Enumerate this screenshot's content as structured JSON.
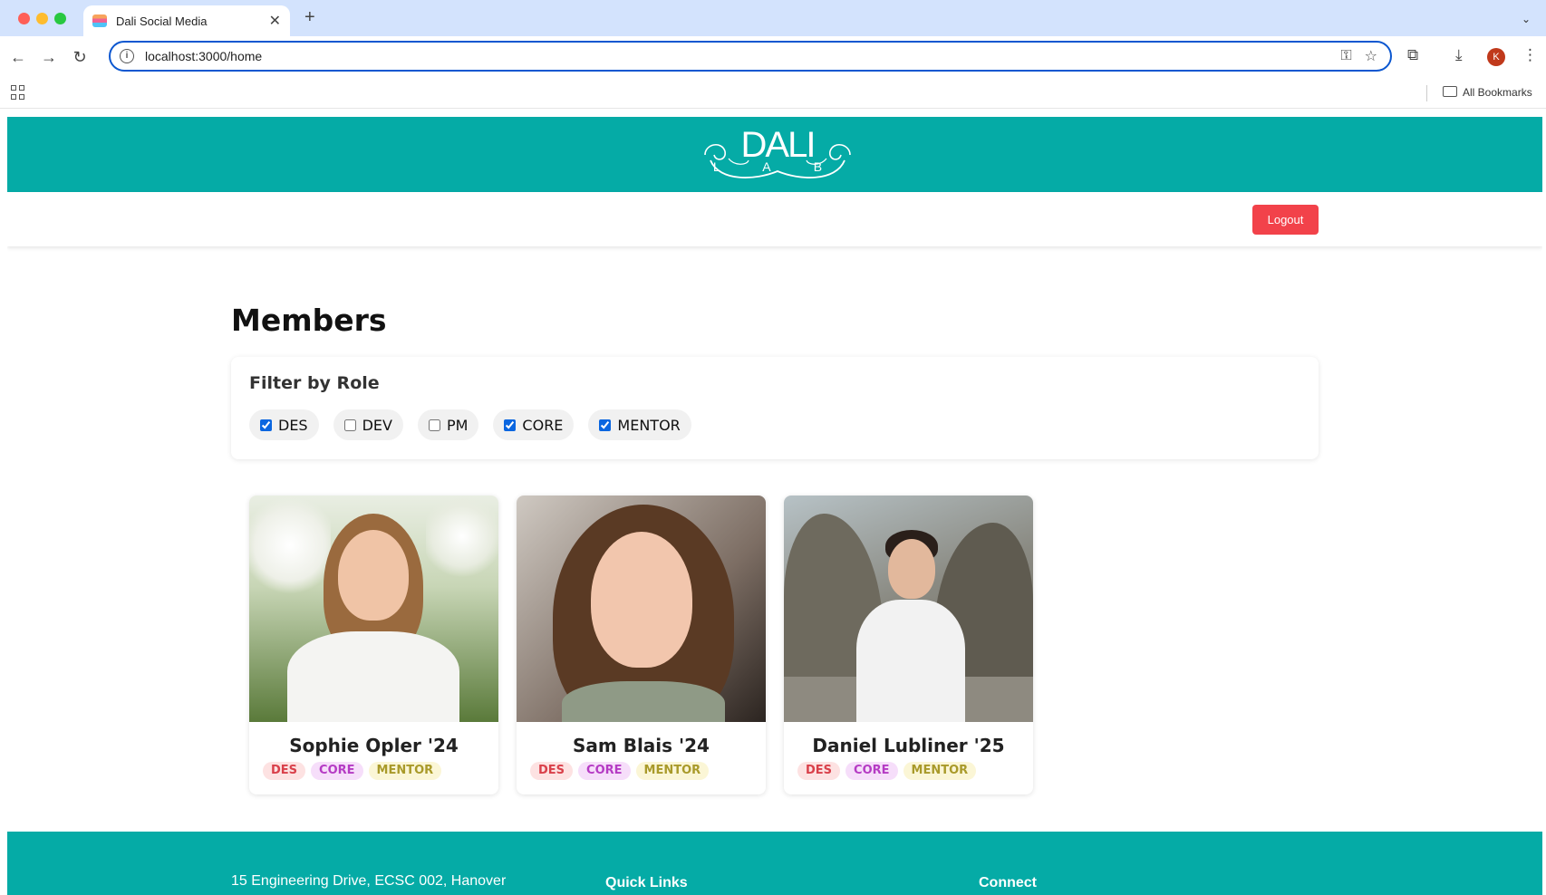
{
  "browser": {
    "tab_title": "Dali Social Media",
    "url": "localhost:3000/home",
    "bookmarks_label": "All Bookmarks",
    "profile_initial": "K"
  },
  "site": {
    "logo_main": "DALI",
    "logo_sub": "L A B",
    "logout_label": "Logout",
    "accent_color": "#05aba6",
    "logout_color": "#f2424a"
  },
  "main": {
    "title": "Members",
    "filter": {
      "title": "Filter by Role",
      "roles": [
        {
          "label": "DES",
          "checked": true
        },
        {
          "label": "DEV",
          "checked": false
        },
        {
          "label": "PM",
          "checked": false
        },
        {
          "label": "CORE",
          "checked": true
        },
        {
          "label": "MENTOR",
          "checked": true
        }
      ]
    },
    "members": [
      {
        "name": "Sophie Opler '24",
        "roles": [
          "DES",
          "CORE",
          "MENTOR"
        ]
      },
      {
        "name": "Sam Blais '24",
        "roles": [
          "DES",
          "CORE",
          "MENTOR"
        ]
      },
      {
        "name": "Daniel Lubliner '25",
        "roles": [
          "DES",
          "CORE",
          "MENTOR"
        ]
      }
    ]
  },
  "footer": {
    "address": "15 Engineering Drive, ECSC 002, Hanover",
    "quick_links": "Quick Links",
    "connect": "Connect"
  }
}
